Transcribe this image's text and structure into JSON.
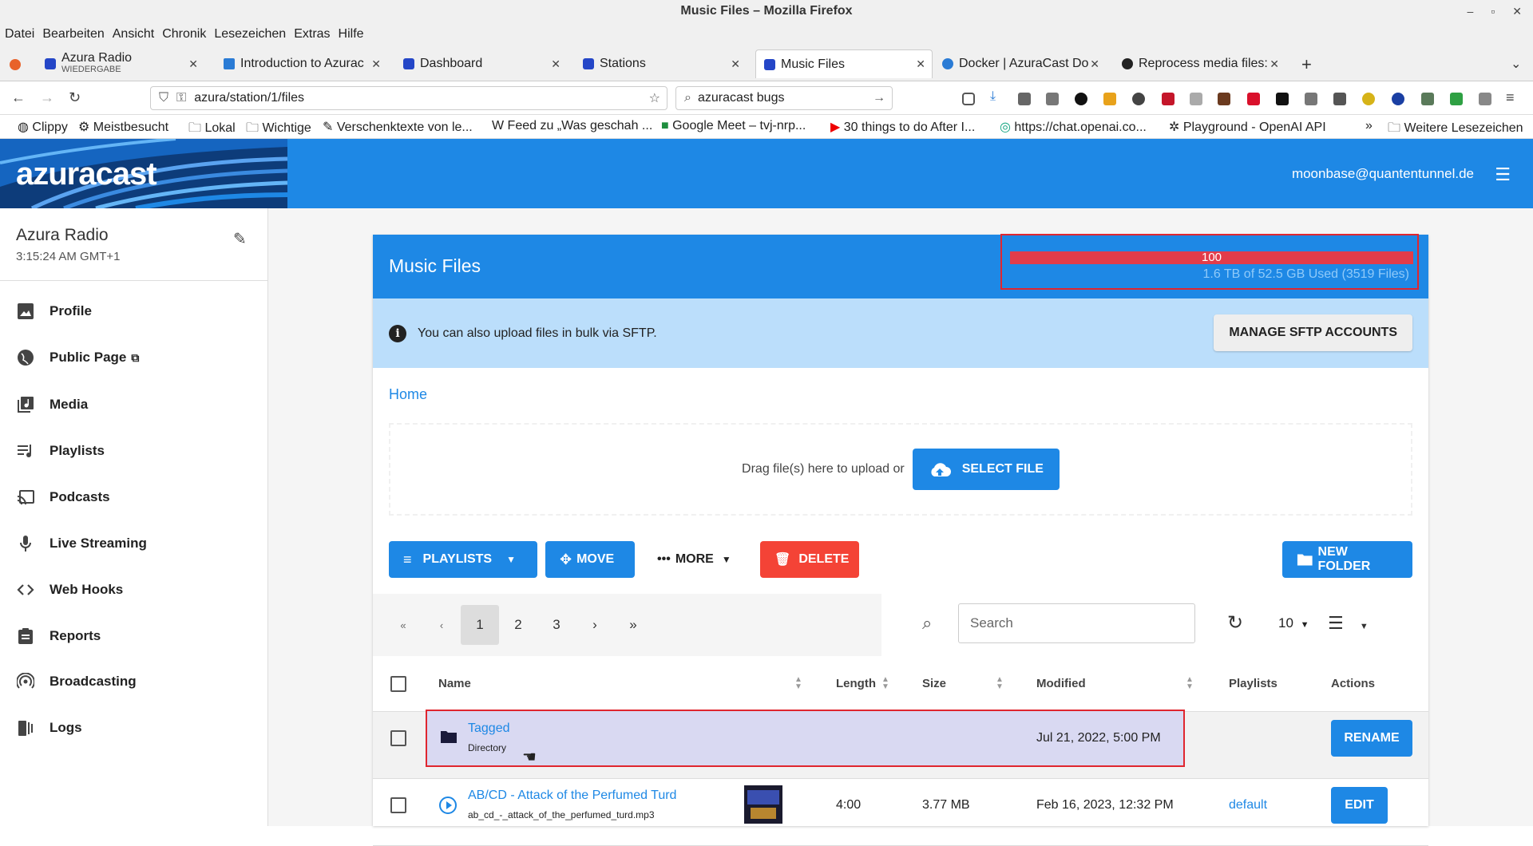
{
  "window": {
    "title": "Music Files – Mozilla Firefox"
  },
  "menu": [
    "Datei",
    "Bearbeiten",
    "Ansicht",
    "Chronik",
    "Lesezeichen",
    "Extras",
    "Hilfe"
  ],
  "tabs": [
    {
      "label": "Azura Radio",
      "sub": "WIEDERGABE",
      "color": "#2446c7"
    },
    {
      "label": "Introduction to Azurac",
      "color": "#2a7bd5"
    },
    {
      "label": "Dashboard",
      "color": "#2446c7"
    },
    {
      "label": "Stations",
      "color": "#2446c7"
    },
    {
      "label": "Music Files",
      "color": "#2446c7"
    },
    {
      "label": "Docker | AzuraCast Do",
      "color": "#2a7bd5"
    },
    {
      "label": "Reprocess media files: ",
      "color": "#222222"
    }
  ],
  "nav": {
    "url": "azura/station/1/files",
    "search": "azuracast bugs"
  },
  "bookmarks": [
    "Clippy",
    "Meistbesucht",
    "Lokal",
    "Wichtige",
    "Verschenktexte von le...",
    "Feed zu „Was geschah ...",
    "Google Meet – tvj-nrp...",
    "30 things to do After I...",
    "https://chat.openai.co...",
    "Playground - OpenAI API",
    "Weitere Lesezeichen"
  ],
  "header": {
    "logo": "azuracast",
    "user": "moonbase@quantentunnel.de"
  },
  "sidebar": {
    "station": "Azura Radio",
    "time": "3:15:24 AM GMT+1",
    "items": [
      {
        "label": "Profile",
        "icon": "image-icon"
      },
      {
        "label": "Public Page",
        "icon": "globe-icon"
      },
      {
        "label": "Media",
        "icon": "music-library-icon"
      },
      {
        "label": "Playlists",
        "icon": "playlist-icon"
      },
      {
        "label": "Podcasts",
        "icon": "cast-icon"
      },
      {
        "label": "Live Streaming",
        "icon": "microphone-icon"
      },
      {
        "label": "Web Hooks",
        "icon": "code-icon"
      },
      {
        "label": "Reports",
        "icon": "clipboard-icon"
      },
      {
        "label": "Broadcasting",
        "icon": "broadcast-icon"
      },
      {
        "label": "Logs",
        "icon": "logs-icon"
      }
    ]
  },
  "card": {
    "title": "Music Files",
    "quota_percent": "100",
    "quota_fraction": 1.0,
    "quota_text": "1.6 TB of 52.5 GB Used (3519 Files)",
    "sftp_text": "You can also upload files in bulk via SFTP.",
    "sftp_button": "MANAGE SFTP ACCOUNTS",
    "breadcrumb": "Home",
    "drop_text": "Drag file(s) here to upload or",
    "select_button": "SELECT FILE",
    "toolbar": {
      "playlists": "PLAYLISTS",
      "move": "MOVE",
      "more": "MORE",
      "delete": "DELETE",
      "new_folder": "NEW FOLDER"
    },
    "pager": {
      "first": "«",
      "prev": "‹",
      "pages": [
        "1",
        "2",
        "3"
      ],
      "next": "›",
      "last": "»"
    },
    "search_placeholder": "Search",
    "per_page": "10",
    "columns": [
      "Name",
      "Length",
      "Size",
      "Modified",
      "Playlists",
      "Actions"
    ],
    "rows": [
      {
        "name": "Tagged",
        "sub": "Directory",
        "length": "",
        "size": "",
        "modified": "Jul 21, 2022, 5:00 PM",
        "playlists": "",
        "action": "RENAME"
      },
      {
        "name": "AB/CD - Attack of the Perfumed Turd",
        "sub": "ab_cd_-_attack_of_the_perfumed_turd.mp3",
        "length": "4:00",
        "size": "3.77 MB",
        "modified": "Feb 16, 2023, 12:32 PM",
        "playlists": "default",
        "action": "EDIT"
      }
    ]
  },
  "colors": {
    "primary": "#1e88e5",
    "danger": "#f44336",
    "highlight": "#e0262f"
  }
}
